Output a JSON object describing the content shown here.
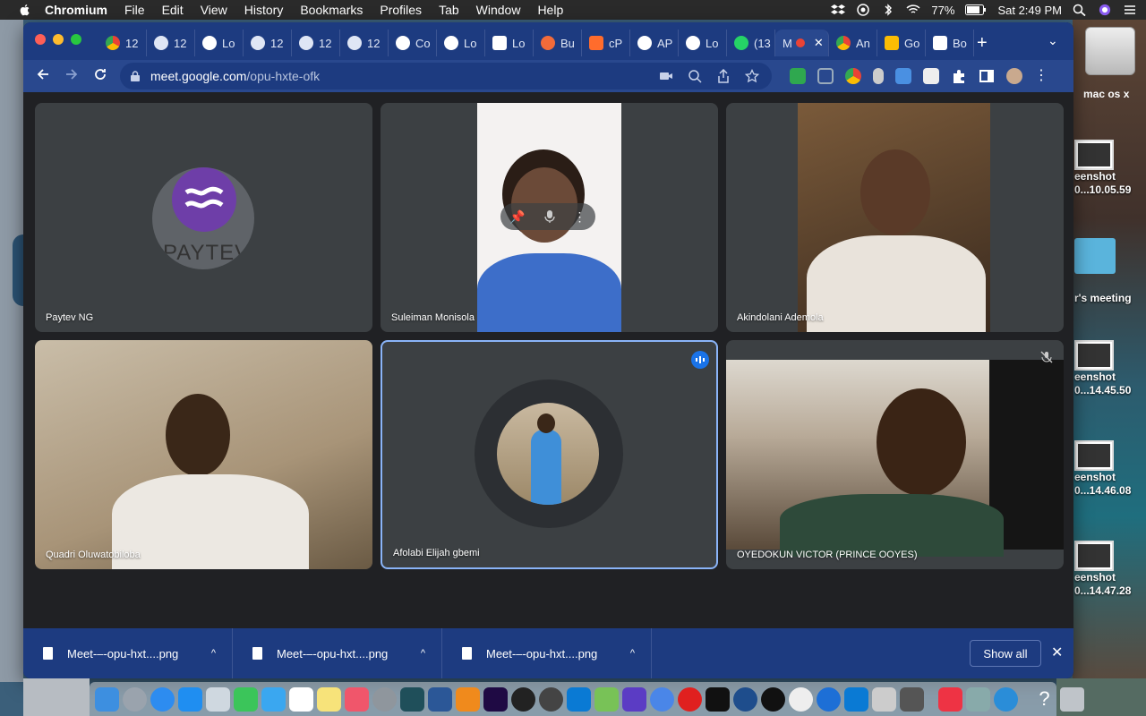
{
  "menubar": {
    "app_name": "Chromium",
    "items": [
      "File",
      "Edit",
      "View",
      "History",
      "Bookmarks",
      "Profiles",
      "Tab",
      "Window",
      "Help"
    ],
    "battery": "77%",
    "clock": "Sat 2:49 PM"
  },
  "browser": {
    "tabs": [
      {
        "label": "12",
        "icon": "chrome-icon"
      },
      {
        "label": "12",
        "icon": "globe-icon"
      },
      {
        "label": "Lo",
        "icon": "r-icon"
      },
      {
        "label": "12",
        "icon": "globe-icon"
      },
      {
        "label": "12",
        "icon": "globe-icon"
      },
      {
        "label": "12",
        "icon": "globe-icon"
      },
      {
        "label": "Co",
        "icon": "openai-icon"
      },
      {
        "label": "Lo",
        "icon": "r-icon"
      },
      {
        "label": "Lo",
        "icon": "h-icon"
      },
      {
        "label": "Bu",
        "icon": "bu-icon"
      },
      {
        "label": "cP",
        "icon": "cpanel-icon"
      },
      {
        "label": "AP",
        "icon": "openai-icon"
      },
      {
        "label": "Lo",
        "icon": "r-icon"
      },
      {
        "label": "(13",
        "icon": "whatsapp-icon"
      },
      {
        "label": "M",
        "icon": "meet-icon",
        "active": true
      },
      {
        "label": "An",
        "icon": "chrome-icon"
      },
      {
        "label": "Go",
        "icon": "keep-icon"
      },
      {
        "label": "Bo",
        "icon": "v-icon"
      }
    ],
    "url_host": "meet.google.com",
    "url_path": "/opu-hxte-ofk",
    "accent": "#1d3b80"
  },
  "meet": {
    "participants": [
      {
        "name": "Paytev NG",
        "type": "logo",
        "logo_text": "PAYTEV"
      },
      {
        "name": "Suleiman Monisola",
        "type": "video"
      },
      {
        "name": "Akindolani Ademola",
        "type": "video"
      },
      {
        "name": "Quadri Oluwatobiloba",
        "type": "video"
      },
      {
        "name": "Afolabi Elijah gbemi",
        "type": "avatar",
        "speaking": true
      },
      {
        "name": "OYEDOKUN VICTOR (PRINCE OOYES)",
        "type": "video",
        "muted": true
      }
    ],
    "meeting_code": "opu-hxte-ofk",
    "people_count": "6"
  },
  "downloads": {
    "items": [
      "Meet-–-opu-hxt....png",
      "Meet-–-opu-hxt....png",
      "Meet-–-opu-hxt....png"
    ],
    "show_all": "Show all"
  },
  "desktop": {
    "drive_label": "mac os x",
    "items": [
      {
        "line1": "eenshot",
        "line2": "0...10.05.59"
      },
      {
        "line1": "r's meeting",
        "line2": ""
      },
      {
        "line1": "eenshot",
        "line2": "0...14.45.50"
      },
      {
        "line1": "eenshot",
        "line2": "0...14.46.08"
      },
      {
        "line1": "eenshot",
        "line2": "0...14.47.28"
      }
    ]
  }
}
